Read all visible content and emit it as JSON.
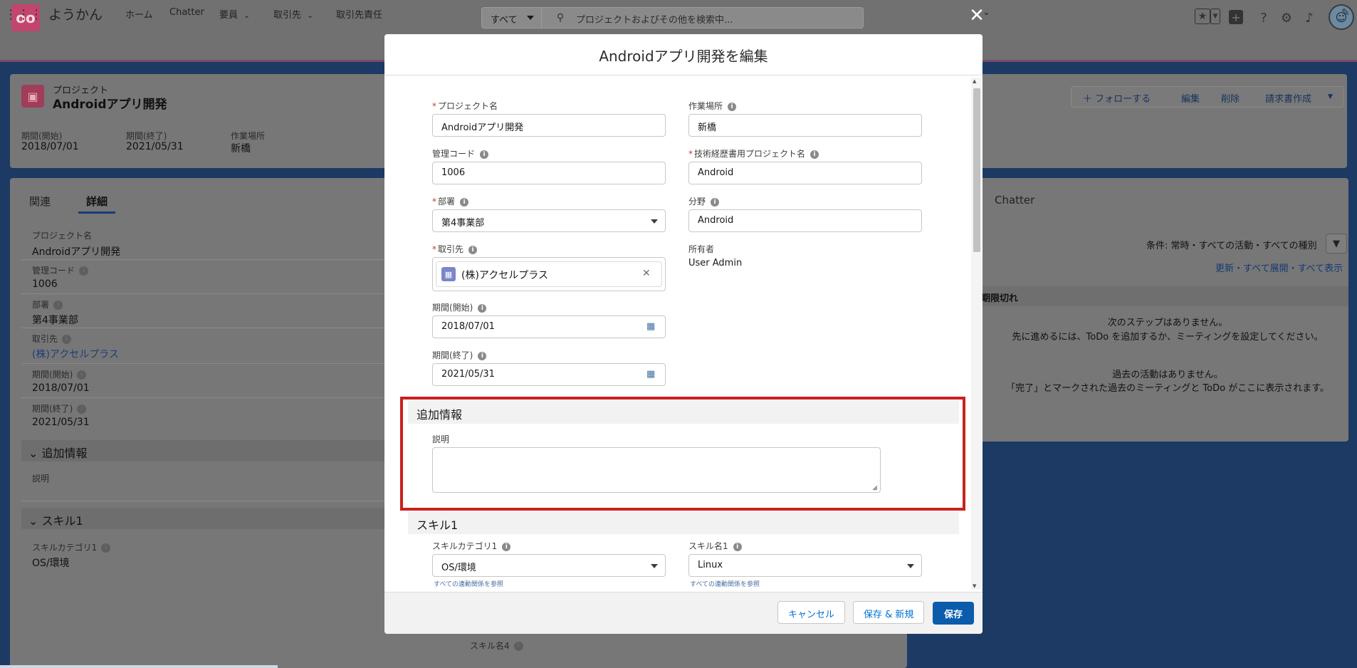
{
  "header": {
    "logo_text": "oo",
    "search_scope": "すべて",
    "search_placeholder": "プロジェクトおよびその他を検索中...",
    "icons": [
      "favorites-star-icon",
      "favorites-dropdown-icon",
      "add-icon",
      "help-icon",
      "setup-gear-icon",
      "notifications-bell-icon",
      "avatar"
    ]
  },
  "nav": {
    "app_name": "ようかん",
    "items": [
      {
        "label": "ホーム",
        "caret": false
      },
      {
        "label": "Chatter",
        "caret": false
      },
      {
        "label": "要員",
        "caret": true
      },
      {
        "label": "取引先",
        "caret": true
      },
      {
        "label": "取引先責任",
        "caret": false
      }
    ]
  },
  "record": {
    "type_label": "プロジェクト",
    "title": "Androidアプリ開発",
    "highlights": [
      {
        "label": "期間(開始)",
        "value": "2018/07/01"
      },
      {
        "label": "期間(終了)",
        "value": "2021/05/31"
      },
      {
        "label": "作業場所",
        "value": "新橋"
      }
    ],
    "buttons": {
      "follow": "＋ フォローする",
      "edit": "編集",
      "delete": "削除",
      "invoice": "請求書作成"
    }
  },
  "detail": {
    "tabs": [
      "関連",
      "詳細"
    ],
    "fields": [
      {
        "label": "プロジェクト名",
        "value": "Androidアプリ開発"
      },
      {
        "label": "管理コード",
        "value": "1006"
      },
      {
        "label": "部署",
        "value": "第4事業部"
      },
      {
        "label": "取引先",
        "value": "(株)アクセルプラス"
      },
      {
        "label": "期間(開始)",
        "value": "2018/07/01"
      },
      {
        "label": "期間(終了)",
        "value": "2021/05/31"
      }
    ],
    "section_additional": "追加情報",
    "description_label": "説明",
    "section_skill": "スキル1",
    "skill_category_label": "スキルカテゴリ1",
    "skill_category_value": "OS/環境",
    "skill_name4_label": "スキル名4"
  },
  "activity": {
    "tab_chatter": "Chatter",
    "filter": "条件: 常時・すべての活動・すべての種別",
    "links": "更新・すべて展開・すべて表示",
    "overdue": "期限切れ",
    "no_steps": "次のステップはありません。",
    "no_steps_hint": "先に進めるには、ToDo を追加するか、ミーティングを設定してください。",
    "no_past": "過去の活動はありません。",
    "no_past_hint": "「完了」とマークされた過去のミーティングと ToDo がここに表示されます。"
  },
  "modal": {
    "title": "Androidアプリ開発を編集",
    "project_name_label": "プロジェクト名",
    "project_name_value": "Androidアプリ開発",
    "location_label": "作業場所",
    "location_value": "新橋",
    "code_label": "管理コード",
    "code_value": "1006",
    "tech_name_label": "技術経歴書用プロジェクト名",
    "tech_name_value": "Android",
    "dept_label": "部署",
    "dept_value": "第4事業部",
    "field_label": "分野",
    "field_value": "Android",
    "account_label": "取引先",
    "account_value": "(株)アクセルプラス",
    "owner_label": "所有者",
    "owner_value": "User Admin",
    "start_label": "期間(開始)",
    "start_value": "2018/07/01",
    "end_label": "期間(終了)",
    "end_value": "2021/05/31",
    "section_additional": "追加情報",
    "description_label": "説明",
    "description_value": "",
    "section_skill": "スキル1",
    "skill_category_label": "スキルカテゴリ1",
    "skill_category_value": "OS/環境",
    "skill_name_label": "スキル名1",
    "skill_name_value": "Linux",
    "dependency_link": "すべての連動関係を参照",
    "cancel": "キャンセル",
    "save_new": "保存 & 新規",
    "save": "保存"
  },
  "colors": {
    "brand_blue": "#0b5cab",
    "highlight_red": "#c9211e",
    "required_red": "#c23934"
  }
}
